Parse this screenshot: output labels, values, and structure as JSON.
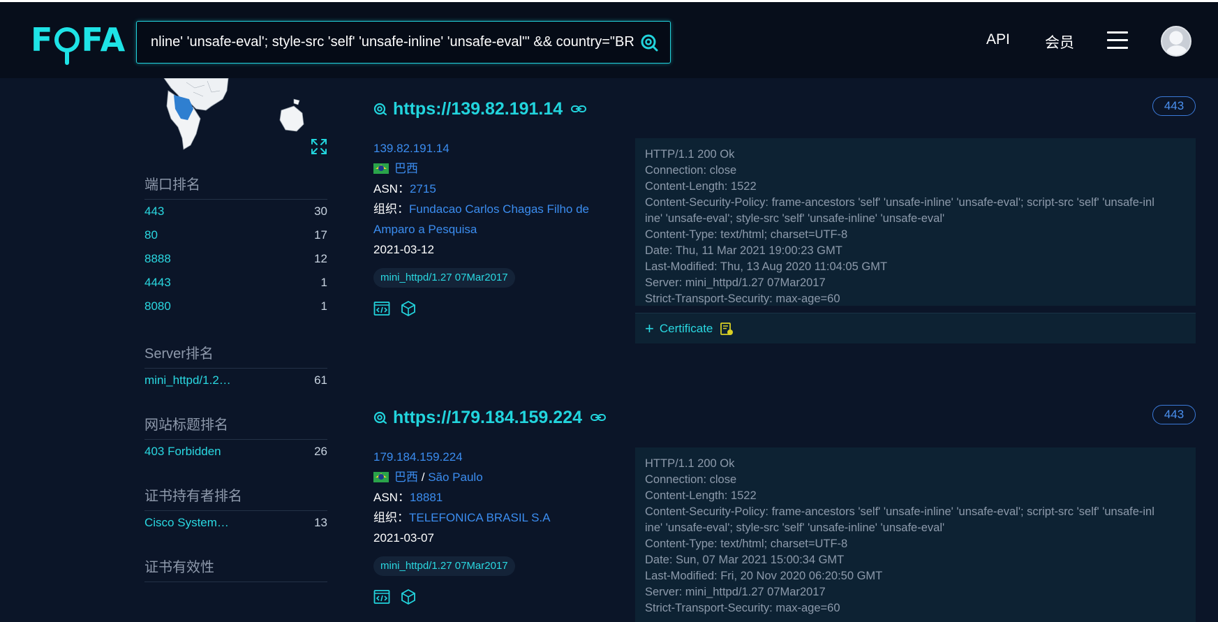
{
  "header": {
    "logo": "FOFA",
    "search_value": "nline' 'unsafe-eval'; style-src 'self' 'unsafe-inline' 'unsafe-eval'\" && country=\"BR\"",
    "nav_api": "API",
    "nav_vip": "会员"
  },
  "sidebar": {
    "port_rank": {
      "title": "端口排名",
      "items": [
        {
          "k": "443",
          "v": "30"
        },
        {
          "k": "80",
          "v": "17"
        },
        {
          "k": "8888",
          "v": "12"
        },
        {
          "k": "4443",
          "v": "1"
        },
        {
          "k": "8080",
          "v": "1"
        }
      ]
    },
    "server_rank": {
      "title": "Server排名",
      "items": [
        {
          "k": "mini_httpd/1.2…",
          "v": "61"
        }
      ]
    },
    "title_rank": {
      "title": "网站标题排名",
      "items": [
        {
          "k": "403 Forbidden",
          "v": "26"
        }
      ]
    },
    "cert_holder_rank": {
      "title": "证书持有者排名",
      "items": [
        {
          "k": "Cisco System…",
          "v": "13"
        }
      ]
    },
    "cert_validity": {
      "title": "证书有效性"
    }
  },
  "results": [
    {
      "url": "https://139.82.191.14",
      "port": "443",
      "ip": "139.82.191.14",
      "country": "巴西",
      "asn_label": "ASN：",
      "asn": "2715",
      "org_label": "组织：",
      "org": "Fundacao Carlos Chagas Filho de Amparo a Pesquisa",
      "date": "2021-03-12",
      "tag": "mini_httpd/1.27 07Mar2017",
      "headers": [
        "HTTP/1.1 200 Ok",
        "Connection: close",
        "Content-Length: 1522",
        "Content-Security-Policy: frame-ancestors 'self' 'unsafe-inline' 'unsafe-eval'; script-src 'self' 'unsafe-inl",
        "ine' 'unsafe-eval'; style-src 'self' 'unsafe-inline' 'unsafe-eval'",
        "Content-Type: text/html; charset=UTF-8",
        "Date: Thu, 11 Mar 2021 19:00:23 GMT",
        "Last-Modified: Thu, 13 Aug 2020 11:04:05 GMT",
        "Server: mini_httpd/1.27 07Mar2017",
        "Strict-Transport-Security: max-age=60"
      ],
      "cert_label": "Certificate"
    },
    {
      "url": "https://179.184.159.224",
      "port": "443",
      "ip": "179.184.159.224",
      "country": "巴西",
      "region_sep": "/",
      "region": "São Paulo",
      "asn_label": "ASN：",
      "asn": "18881",
      "org_label": "组织：",
      "org": "TELEFONICA BRASIL S.A",
      "date": "2021-03-07",
      "tag": "mini_httpd/1.27 07Mar2017",
      "headers": [
        "HTTP/1.1 200 Ok",
        "Connection: close",
        "Content-Length: 1522",
        "Content-Security-Policy: frame-ancestors 'self' 'unsafe-inline' 'unsafe-eval'; script-src 'self' 'unsafe-inl",
        "ine' 'unsafe-eval'; style-src 'self' 'unsafe-inline' 'unsafe-eval'",
        "Content-Type: text/html; charset=UTF-8",
        "Date: Sun, 07 Mar 2021 15:00:34 GMT",
        "Last-Modified: Fri, 20 Nov 2020 06:20:50 GMT",
        "Server: mini_httpd/1.27 07Mar2017",
        "Strict-Transport-Security: max-age=60"
      ]
    }
  ],
  "colors": {
    "accent": "#22d4dd",
    "link": "#3b8df0",
    "background": "#0b1528"
  }
}
